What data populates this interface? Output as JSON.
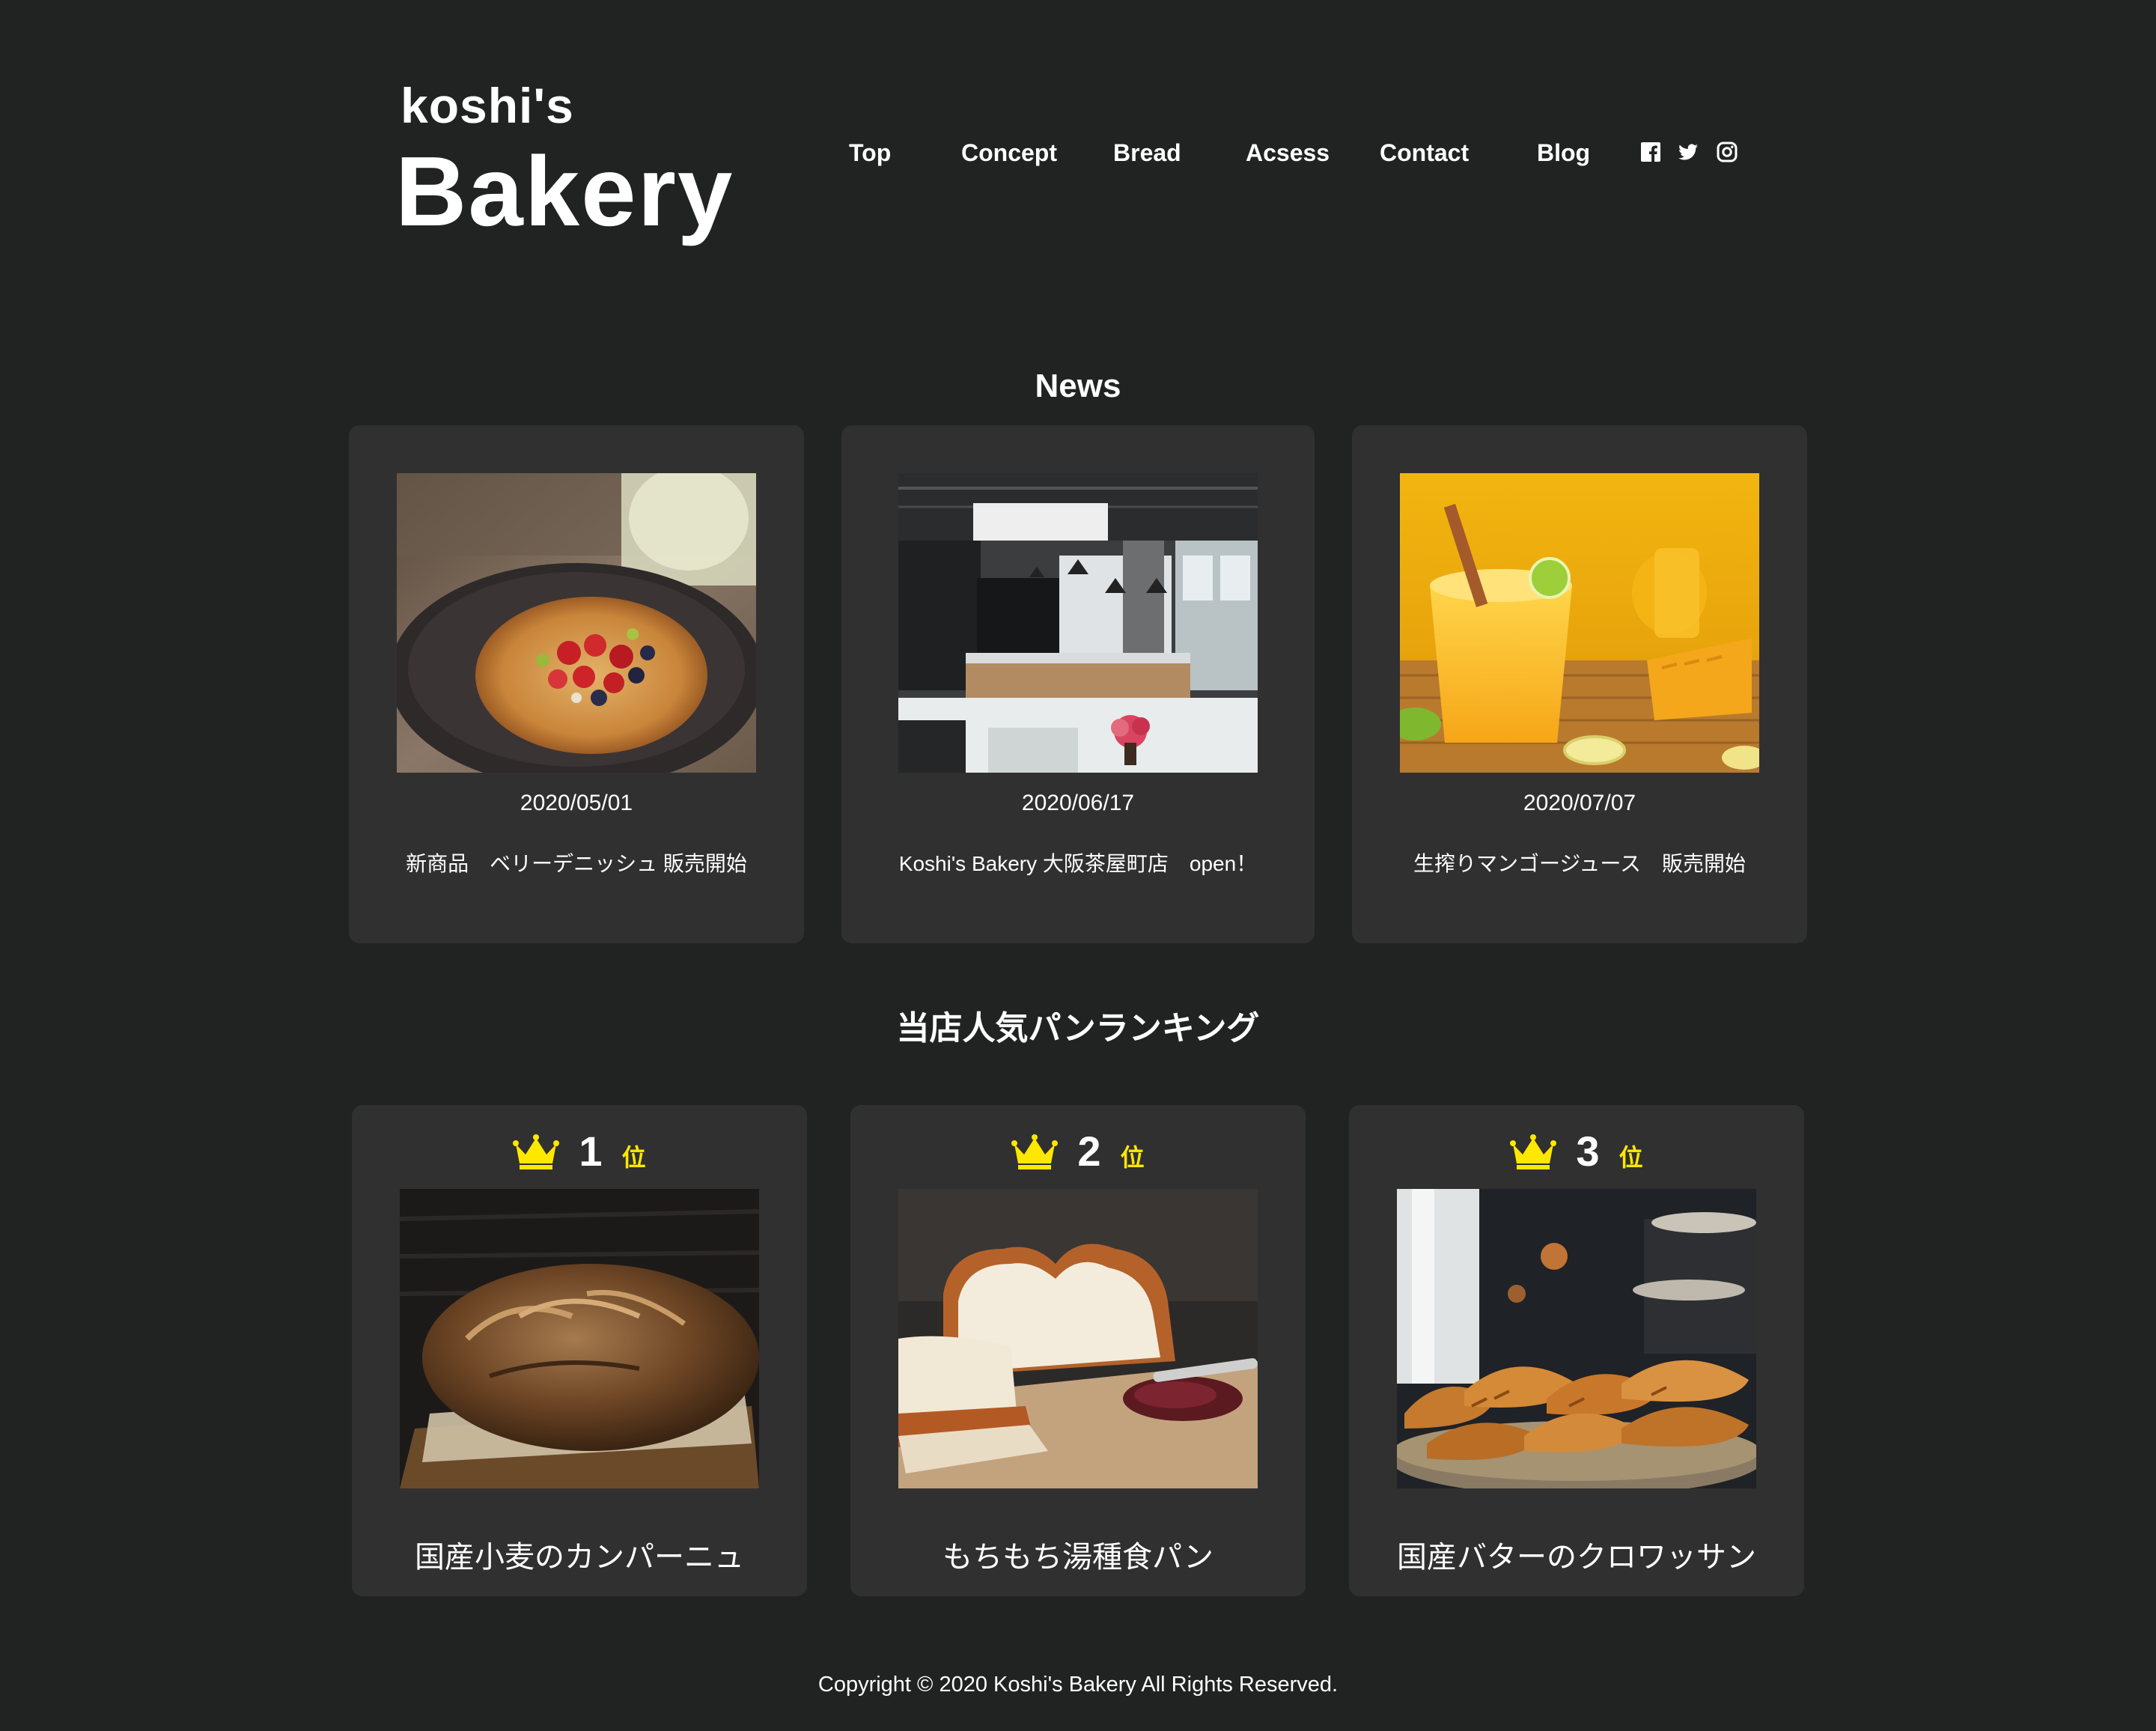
{
  "brand": {
    "line1": "koshi's",
    "line2": "Bakery"
  },
  "nav": {
    "items": [
      "Top",
      "Concept",
      "Bread",
      "Acsess",
      "Contact",
      "Blog"
    ],
    "social_icons": [
      "facebook-icon",
      "twitter-icon",
      "instagram-icon"
    ]
  },
  "news": {
    "title": "News",
    "items": [
      {
        "date": "2020/05/01",
        "text": "新商品　ベリーデニッシュ 販売開始",
        "image": "berry-danish-photo"
      },
      {
        "date": "2020/06/17",
        "text": "Koshi's Bakery 大阪茶屋町店　open！",
        "image": "bakery-shop-interior-photo"
      },
      {
        "date": "2020/07/07",
        "text": "生搾りマンゴージュース　販売開始",
        "image": "mango-juice-photo"
      }
    ]
  },
  "ranking": {
    "title": "当店人気パンランキング",
    "unit": "位",
    "items": [
      {
        "rank": "1",
        "name": "国産小麦のカンパーニュ",
        "image": "campagne-bread-photo"
      },
      {
        "rank": "2",
        "name": "もちもち湯種食パン",
        "image": "yudane-bread-photo"
      },
      {
        "rank": "3",
        "name": "国産バターのクロワッサン",
        "image": "croissant-photo"
      }
    ]
  },
  "footer": {
    "copyright": "Copyright © 2020 Koshi's Bakery All Rights Reserved."
  },
  "colors": {
    "background": "#212222",
    "card": "#303030",
    "crown": "#ffe800",
    "text": "#ffffff"
  }
}
